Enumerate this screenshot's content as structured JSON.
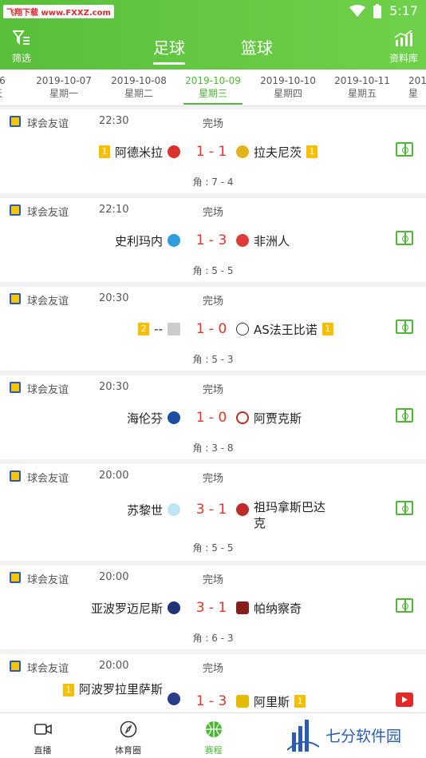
{
  "status_bar": {
    "watermark": "飞翔下载 www.FXXZ.com",
    "time": "5:17"
  },
  "nav": {
    "filter_label": "筛选",
    "tabs": [
      {
        "label": "足球"
      },
      {
        "label": "篮球"
      }
    ],
    "library_label": "资料库"
  },
  "dates": [
    {
      "date": "-06",
      "weekday": "天"
    },
    {
      "date": "2019-10-07",
      "weekday": "星期一"
    },
    {
      "date": "2019-10-08",
      "weekday": "星期二"
    },
    {
      "date": "2019-10-09",
      "weekday": "星期三"
    },
    {
      "date": "2019-10-10",
      "weekday": "星期四"
    },
    {
      "date": "2019-10-11",
      "weekday": "星期五"
    },
    {
      "date": "201",
      "weekday": "星"
    }
  ],
  "matches": [
    {
      "league": "球会友谊",
      "time": "22:30",
      "status": "完场",
      "home": "阿德米拉",
      "home_rank": "1",
      "score": "1 - 1",
      "away": "拉夫尼茨",
      "away_rank": "1",
      "corners": "角 : 7 - 4"
    },
    {
      "league": "球会友谊",
      "time": "22:10",
      "status": "完场",
      "home": "史利玛内",
      "score": "1 - 3",
      "away": "非洲人",
      "corners": "角 : 5 - 5"
    },
    {
      "league": "球会友谊",
      "time": "20:30",
      "status": "完场",
      "home": "--",
      "home_rank": "2",
      "score": "1 - 0",
      "away": "AS法王比诺",
      "away_rank": "1",
      "corners": "角 : 5 - 3"
    },
    {
      "league": "球会友谊",
      "time": "20:30",
      "status": "完场",
      "home": "海伦芬",
      "score": "1 - 0",
      "away": "阿贾克斯",
      "corners": "角 : 3 - 8"
    },
    {
      "league": "球会友谊",
      "time": "20:00",
      "status": "完场",
      "home": "苏黎世",
      "score": "3 - 1",
      "away": "祖玛拿斯巴达克",
      "corners": "角 : 5 - 5"
    },
    {
      "league": "球会友谊",
      "time": "20:00",
      "status": "完场",
      "home": "亚波罗迈尼斯",
      "score": "3 - 1",
      "away": "帕纳察奇",
      "corners": "角 : 6 - 3"
    },
    {
      "league": "球会友谊",
      "time": "20:00",
      "status": "完场",
      "home": "阿波罗拉里萨斯",
      "home_rank": "1",
      "score": "1 - 3",
      "away": "阿里斯",
      "away_rank": "1",
      "corners": ""
    }
  ],
  "bottom_nav": [
    {
      "label": "直播"
    },
    {
      "label": "体育圈"
    },
    {
      "label": "赛程"
    }
  ],
  "watermark_bottom": "七分软件园",
  "colors": {
    "brand": "#5cc33d",
    "score": "#e0342a"
  }
}
